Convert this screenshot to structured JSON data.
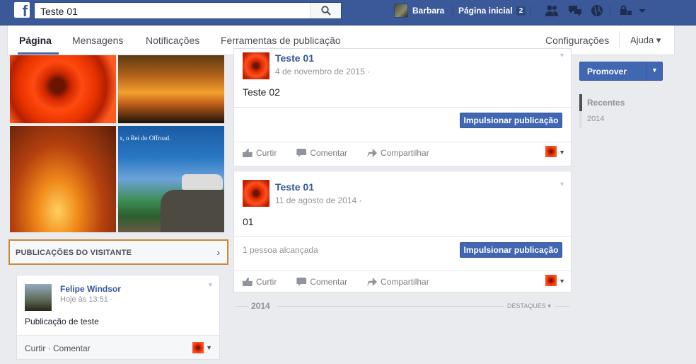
{
  "topbar": {
    "search_value": "Teste 01",
    "user_name": "Barbara",
    "home_label": "Página inicial",
    "home_badge": "2"
  },
  "page_nav": {
    "tabs": [
      {
        "label": "Página"
      },
      {
        "label": "Mensagens"
      },
      {
        "label": "Notificações"
      },
      {
        "label": "Ferramentas de publicação"
      }
    ],
    "settings_label": "Configurações",
    "help_label": "Ajuda ▾"
  },
  "photos": {
    "banner_text": "x, o Rei do Offroad."
  },
  "visitor_posts": {
    "title": "PUBLICAÇÕES DO VISITANTE",
    "chevron": "›",
    "card": {
      "author": "Felipe Windsor",
      "time": "Hoje às 13:51 ·",
      "body": "Publicação de teste",
      "actions": "Curtir · Comentar"
    }
  },
  "posts": [
    {
      "name": "Teste 01",
      "date": "4 de novembro de 2015 ·",
      "text": "Teste 02",
      "boost_label": "Impulsionar publicação",
      "reach": "",
      "actions": [
        "Curtir",
        "Comentar",
        "Compartilhar"
      ]
    },
    {
      "name": "Teste 01",
      "date": "11 de agosto de 2014 ·",
      "text": "01",
      "boost_label": "Impulsionar publicação",
      "reach": "1 pessoa alcançada",
      "actions": [
        "Curtir",
        "Comentar",
        "Compartilhar"
      ]
    }
  ],
  "timeline": {
    "year": "2014",
    "highlights": "DESTAQUES ▾"
  },
  "right_column": {
    "promote_label": "Promover",
    "recent_label": "Recentes",
    "recent_year": "2014"
  },
  "colors": {
    "brand": "#3b5998",
    "button": "#4267b2",
    "link": "#365899",
    "highlight_border": "#c78a3b"
  },
  "icons": [
    "facebook-logo-icon",
    "search-icon",
    "friends-icon",
    "messages-icon",
    "globe-icon",
    "privacy-icon",
    "chevron-down-icon",
    "like-icon",
    "comment-icon",
    "share-icon"
  ]
}
